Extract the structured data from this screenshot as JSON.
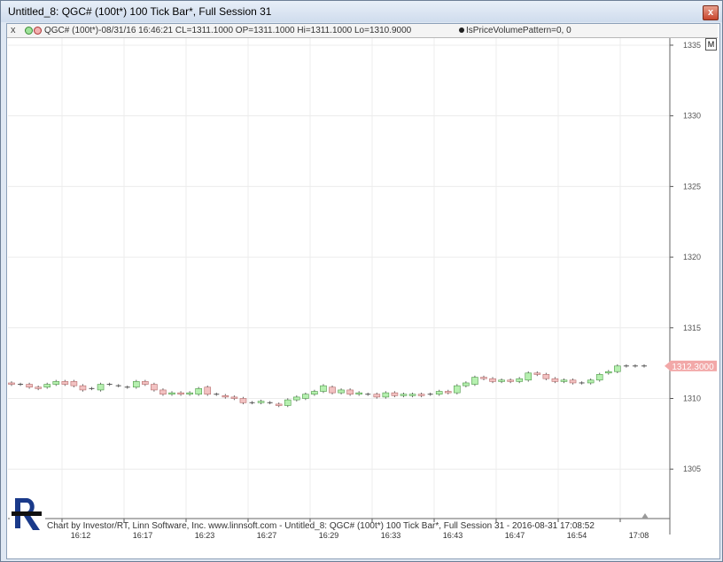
{
  "window": {
    "title": "Untitled_8: QGC# (100t*) 100 Tick Bar*, Full Session 31",
    "close_glyph": "x"
  },
  "infobar": {
    "close_glyph": "x",
    "quote": "QGC# (100t*)-08/31/16 16:46:21 CL=1311.1000 OP=1311.1000 Hi=1311.1000 Lo=1310.9000",
    "pattern": "IsPriceVolumePattern=0, 0",
    "icon": "colored-circles-icon"
  },
  "m_button": "M",
  "footer": "Chart by Investor/RT, Linn Software, Inc. www.linnsoft.com - Untitled_8: QGC# (100t*) 100 Tick Bar*, Full Session 31 - 2016-08-31 17:08:52",
  "colors": {
    "up": "#b6f0b0",
    "down": "#f2c2c2",
    "last_price_bg": "#f2a8a8",
    "grid": "#ececec"
  },
  "chart_data": {
    "type": "candlestick",
    "y_ticks": [
      1305,
      1310,
      1315,
      1320,
      1325,
      1330,
      1335
    ],
    "ylim": [
      1301.5,
      1335.5
    ],
    "x_tick_labels": [
      "16:12",
      "16:17",
      "16:23",
      "16:27",
      "16:29",
      "16:33",
      "16:43",
      "16:47",
      "16:54",
      "17:08"
    ],
    "last_price": "1312.3000",
    "bars": [
      {
        "o": 1311.1,
        "c": 1311.0
      },
      {
        "o": 1311.0,
        "c": 1311.0
      },
      {
        "o": 1311.0,
        "c": 1310.8
      },
      {
        "o": 1310.8,
        "c": 1310.7
      },
      {
        "o": 1310.8,
        "c": 1311.0
      },
      {
        "o": 1311.0,
        "c": 1311.2
      },
      {
        "o": 1311.2,
        "c": 1311.0
      },
      {
        "o": 1311.2,
        "c": 1310.9
      },
      {
        "o": 1310.9,
        "c": 1310.6
      },
      {
        "o": 1310.7,
        "c": 1310.7
      },
      {
        "o": 1310.6,
        "c": 1311.0
      },
      {
        "o": 1311.0,
        "c": 1311.0
      },
      {
        "o": 1310.9,
        "c": 1310.9
      },
      {
        "o": 1310.8,
        "c": 1310.8
      },
      {
        "o": 1310.8,
        "c": 1311.2
      },
      {
        "o": 1311.2,
        "c": 1311.0
      },
      {
        "o": 1311.0,
        "c": 1310.6
      },
      {
        "o": 1310.6,
        "c": 1310.3
      },
      {
        "o": 1310.3,
        "c": 1310.4
      },
      {
        "o": 1310.4,
        "c": 1310.3
      },
      {
        "o": 1310.3,
        "c": 1310.4
      },
      {
        "o": 1310.3,
        "c": 1310.7
      },
      {
        "o": 1310.8,
        "c": 1310.3
      },
      {
        "o": 1310.3,
        "c": 1310.3
      },
      {
        "o": 1310.2,
        "c": 1310.1
      },
      {
        "o": 1310.1,
        "c": 1310.0
      },
      {
        "o": 1310.0,
        "c": 1309.7
      },
      {
        "o": 1309.7,
        "c": 1309.7
      },
      {
        "o": 1309.7,
        "c": 1309.8
      },
      {
        "o": 1309.7,
        "c": 1309.7
      },
      {
        "o": 1309.6,
        "c": 1309.5
      },
      {
        "o": 1309.5,
        "c": 1309.9
      },
      {
        "o": 1309.9,
        "c": 1310.1
      },
      {
        "o": 1310.0,
        "c": 1310.3
      },
      {
        "o": 1310.3,
        "c": 1310.5
      },
      {
        "o": 1310.5,
        "c": 1310.9
      },
      {
        "o": 1310.8,
        "c": 1310.4
      },
      {
        "o": 1310.4,
        "c": 1310.6
      },
      {
        "o": 1310.6,
        "c": 1310.3
      },
      {
        "o": 1310.3,
        "c": 1310.4
      },
      {
        "o": 1310.3,
        "c": 1310.3
      },
      {
        "o": 1310.3,
        "c": 1310.1
      },
      {
        "o": 1310.1,
        "c": 1310.4
      },
      {
        "o": 1310.4,
        "c": 1310.2
      },
      {
        "o": 1310.2,
        "c": 1310.3
      },
      {
        "o": 1310.2,
        "c": 1310.3
      },
      {
        "o": 1310.3,
        "c": 1310.2
      },
      {
        "o": 1310.3,
        "c": 1310.3
      },
      {
        "o": 1310.3,
        "c": 1310.5
      },
      {
        "o": 1310.5,
        "c": 1310.4
      },
      {
        "o": 1310.4,
        "c": 1310.9
      },
      {
        "o": 1310.9,
        "c": 1311.1
      },
      {
        "o": 1311.0,
        "c": 1311.5
      },
      {
        "o": 1311.5,
        "c": 1311.4
      },
      {
        "o": 1311.4,
        "c": 1311.2
      },
      {
        "o": 1311.2,
        "c": 1311.3
      },
      {
        "o": 1311.3,
        "c": 1311.2
      },
      {
        "o": 1311.2,
        "c": 1311.4
      },
      {
        "o": 1311.3,
        "c": 1311.8
      },
      {
        "o": 1311.8,
        "c": 1311.7
      },
      {
        "o": 1311.7,
        "c": 1311.4
      },
      {
        "o": 1311.4,
        "c": 1311.2
      },
      {
        "o": 1311.2,
        "c": 1311.3
      },
      {
        "o": 1311.3,
        "c": 1311.1
      },
      {
        "o": 1311.1,
        "c": 1311.1
      },
      {
        "o": 1311.1,
        "c": 1311.3
      },
      {
        "o": 1311.3,
        "c": 1311.7
      },
      {
        "o": 1311.8,
        "c": 1311.9
      },
      {
        "o": 1311.9,
        "c": 1312.3
      },
      {
        "o": 1312.3,
        "c": 1312.3
      },
      {
        "o": 1312.3,
        "c": 1312.3
      },
      {
        "o": 1312.3,
        "c": 1312.3
      }
    ]
  }
}
